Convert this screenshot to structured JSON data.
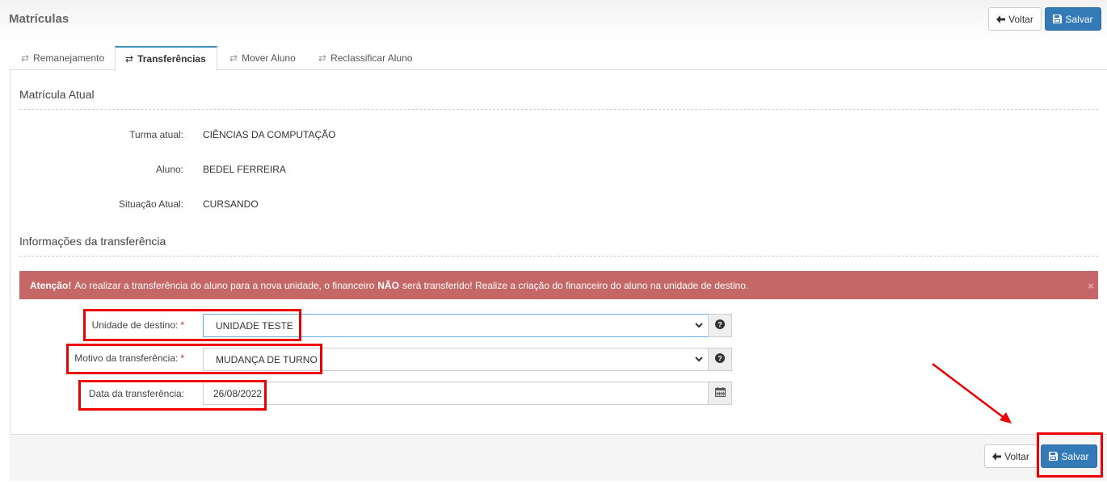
{
  "header": {
    "title": "Matrículas",
    "back_label": "Voltar",
    "save_label": "Salvar"
  },
  "tabs": [
    {
      "label": "Remanejamento",
      "active": false
    },
    {
      "label": "Transferências",
      "active": true
    },
    {
      "label": "Mover Aluno",
      "active": false
    },
    {
      "label": "Reclassificar Aluno",
      "active": false
    }
  ],
  "current_enrollment": {
    "title": "Matrícula Atual",
    "rows": [
      {
        "label": "Turma atual:",
        "value": "CIÊNCIAS DA COMPUTAÇÃO"
      },
      {
        "label": "Aluno:",
        "value": "BEDEL FERREIRA"
      },
      {
        "label": "Situação Atual:",
        "value": "CURSANDO"
      }
    ]
  },
  "transfer_info": {
    "title": "Informações da transferência",
    "alert": {
      "strong": "Atenção!",
      "text_before": "Ao realizar a transferência do aluno para a nova unidade, o financeiro",
      "emphasis": "NÃO",
      "text_after": "será transferido! Realize a criação do financeiro do aluno na unidade de destino.",
      "close": "×"
    },
    "fields": {
      "destination": {
        "label": "Unidade de destino:",
        "required": "*",
        "value": "UNIDADE TESTE"
      },
      "reason": {
        "label": "Motivo da transferência:",
        "required": "*",
        "value": "MUDANÇA DE TURNO"
      },
      "date": {
        "label": "Data da transferência:",
        "value": "26/08/2022"
      }
    }
  },
  "footer": {
    "back_label": "Voltar",
    "save_label": "Salvar"
  },
  "colors": {
    "primary": "#337ab7",
    "alert_bg": "#c56767",
    "annotation": "#e00000"
  }
}
